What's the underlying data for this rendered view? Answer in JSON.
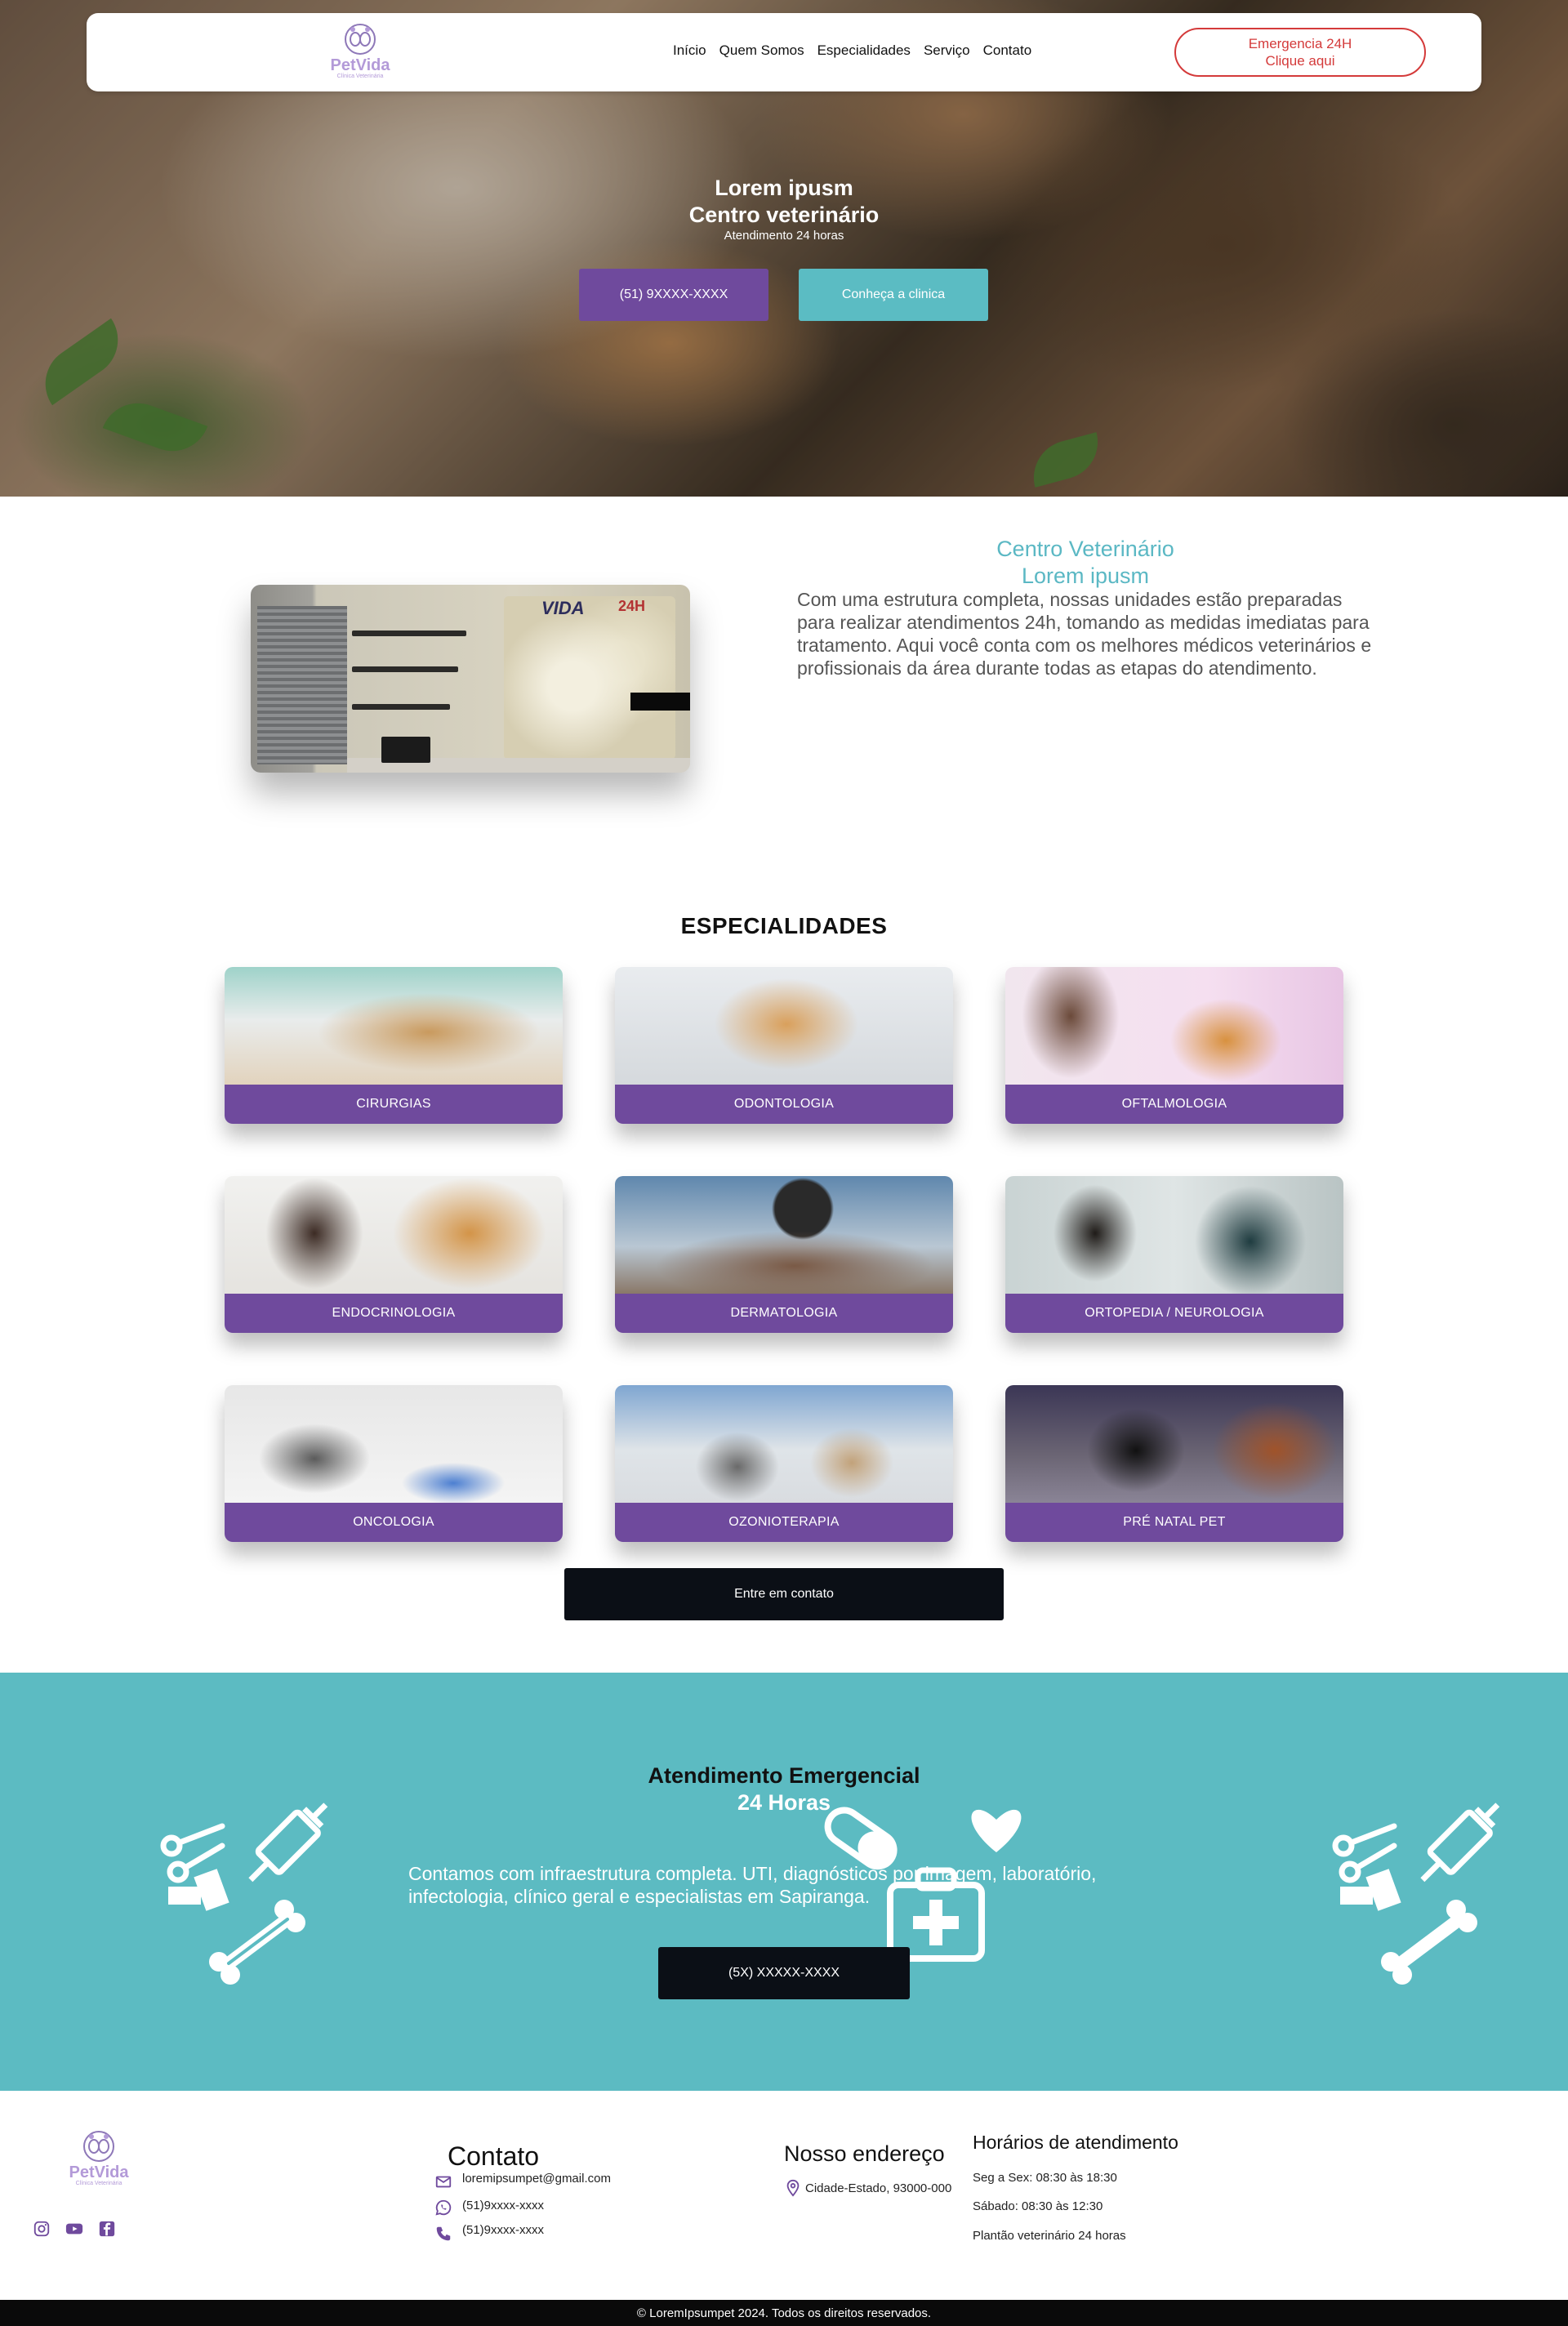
{
  "brand": {
    "name": "PetVida",
    "tagline": "Clínica Veterinária",
    "accent": "#6f4a9d",
    "teal": "#5bbcc3",
    "alert": "#d43a3a"
  },
  "nav": {
    "links": [
      "Início",
      "Quem Somos",
      "Especialidades",
      "Serviço",
      "Contato"
    ],
    "emergency_line1": "Emergencia 24H",
    "emergency_line2": "Clique aqui"
  },
  "hero": {
    "title_line1": "Lorem ipusm",
    "title_line2": "Centro veterinário",
    "subtitle": "Atendimento 24 horas",
    "phone_button": "(51) 9XXXX-XXXX",
    "clinic_button": "Conheça a clinica"
  },
  "about": {
    "title_line1": "Centro Veterinário",
    "title_line2": "Lorem ipusm",
    "text": "Com uma estrutura completa, nossas unidades estão preparadas para realizar atendimentos 24h, tomando as medidas imediatas para tratamento. Aqui você conta com os melhores médicos veterinários e profissionais da área durante todas as etapas do atendimento.",
    "image_sign": "VIDA",
    "image_sign_24": "24H"
  },
  "specialties": {
    "heading": "ESPECIALIDADES",
    "items": [
      "CIRURGIAS",
      "ODONTOLOGIA",
      "OFTALMOLOGIA",
      "ENDOCRINOLOGIA",
      "DERMATOLOGIA",
      "ORTOPEDIA / NEUROLOGIA",
      "ONCOLOGIA",
      "OZONIOTERAPIA",
      "PRÉ NATAL PET"
    ],
    "contact_button": "Entre em contato"
  },
  "emergency": {
    "title_line1": "Atendimento Emergencial",
    "title_line2": "24 Horas",
    "text": "Contamos com infraestrutura completa. UTI, diagnósticos por imagem, laboratório, infectologia, clínico geral e especialistas em Sapiranga.",
    "phone_button": "(5X) XXXXX-XXXX"
  },
  "footer": {
    "contact_heading": "Contato",
    "email": "loremipsumpet@gmail.com",
    "whatsapp": "(51)9xxxx-xxxx",
    "phone": "(51)9xxxx-xxxx",
    "address_heading": "Nosso endereço",
    "address": "Cidade-Estado, 93000-000",
    "hours_heading": "Horários de atendimento",
    "hours": [
      "Seg a Sex: 08:30 às 18:30",
      "Sábado: 08:30 às 12:30",
      "Plantão veterinário 24 horas"
    ],
    "socials": [
      "instagram-icon",
      "youtube-icon",
      "facebook-icon"
    ],
    "copyright": "© LoremIpsumpet 2024. Todos os direitos reservados."
  }
}
